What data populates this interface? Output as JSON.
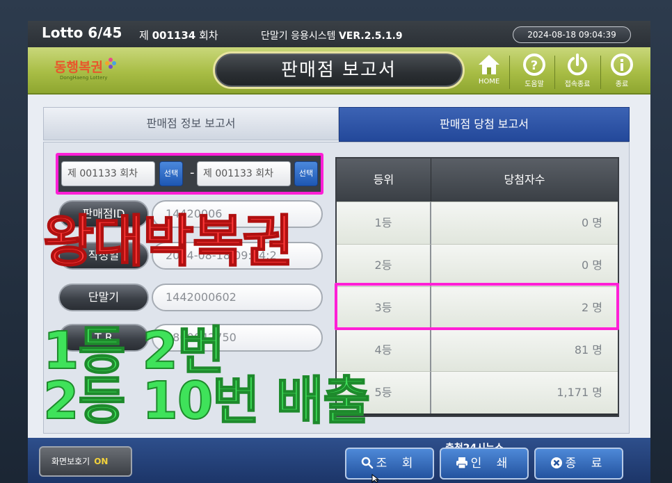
{
  "topbar": {
    "app": "Lotto 6/45",
    "round_prefix": "제",
    "round_no": "001134",
    "round_suffix": "회차",
    "system": "단말기 응용시스템",
    "version": "VER.2.5.1.9",
    "datetime": "2024-08-18 09:04:39"
  },
  "header": {
    "logo": "동행복권",
    "logo_sub": "DongHaeng Lottery",
    "title": "판매점 보고서",
    "buttons": [
      {
        "label": "HOME",
        "icon": "home-icon"
      },
      {
        "label": "도움말",
        "icon": "help-icon"
      },
      {
        "label": "접속종료",
        "icon": "power-icon"
      },
      {
        "label": "종료",
        "icon": "info-icon"
      }
    ]
  },
  "tabs": {
    "info": "판매점 정보 보고서",
    "win": "판매점 당첨 보고서"
  },
  "round_selector": {
    "from": "제 001133 회차",
    "to": "제 001133 회차",
    "select_label": "선택",
    "separator": "-"
  },
  "info": {
    "rows": [
      {
        "label": "판매점ID",
        "value": "14420006"
      },
      {
        "label": "작성일",
        "value": "2024-08-18 09:04:2"
      },
      {
        "label": "단말기",
        "value": "1442000602"
      },
      {
        "label": "T R",
        "value": "1800042750"
      }
    ]
  },
  "table": {
    "headers": [
      "등위",
      "당첨자수"
    ],
    "unit": "명",
    "rows": [
      {
        "rank": "1등",
        "count": "0"
      },
      {
        "rank": "2등",
        "count": "0"
      },
      {
        "rank": "3등",
        "count": "2"
      },
      {
        "rank": "4등",
        "count": "81"
      },
      {
        "rank": "5등",
        "count": "1,171"
      }
    ]
  },
  "bottom": {
    "screensaver": "화면보호기",
    "screensaver_state": "ON",
    "search": "조 회",
    "print": "인 쇄",
    "exit": "종 료",
    "watermark": "충청24시뉴스"
  },
  "overlay": {
    "title": "왕대박복권",
    "line1": "1등 2번",
    "line2": "2등 10번 배출"
  },
  "colors": {
    "header_green": "#a8bd45",
    "tab_active": "#23489a",
    "highlight": "#ff1fd6",
    "overlay_red": "#ff3a3a",
    "overlay_green": "#3fe25a"
  }
}
